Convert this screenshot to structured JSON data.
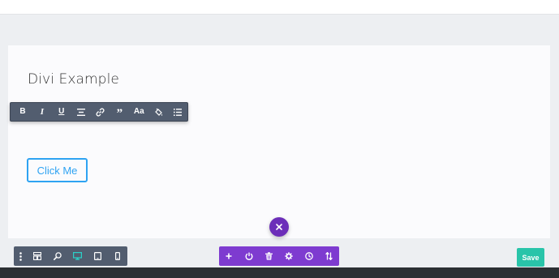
{
  "page": {
    "heading": "Divi Example",
    "cta_label": "Click Me"
  },
  "text_toolbar": {
    "items": [
      {
        "name": "bold",
        "glyph": "B"
      },
      {
        "name": "italic",
        "glyph": "I"
      },
      {
        "name": "underline",
        "glyph": "U"
      },
      {
        "name": "align",
        "glyph": "align-icon"
      },
      {
        "name": "link",
        "glyph": "link-icon"
      },
      {
        "name": "quote",
        "glyph": "”"
      },
      {
        "name": "font",
        "glyph": "Aa"
      },
      {
        "name": "text-color",
        "glyph": "paint-bucket-icon"
      },
      {
        "name": "list",
        "glyph": "list-icon"
      }
    ],
    "bold_label": "B",
    "italic_label": "I",
    "underline_label": "U",
    "quote_label": "”",
    "font_label": "Aa"
  },
  "view_toolbar": {
    "icons": [
      "menu-dots-icon",
      "wireframe-icon",
      "zoom-icon",
      "desktop-icon",
      "tablet-icon",
      "phone-icon"
    ],
    "active": "desktop-icon"
  },
  "action_toolbar": {
    "icons": [
      "plus-icon",
      "power-icon",
      "trash-icon",
      "settings-icon",
      "history-icon",
      "portability-icon"
    ]
  },
  "close_fab_icon": "close-icon",
  "save_label": "Save",
  "colors": {
    "builder_purple": "#7e3bd0",
    "fab_purple": "#6c2eb9",
    "toolbar_gray": "#525d6f",
    "cta_blue": "#2ea3f2",
    "save_green": "#29c4a9",
    "active_teal": "#2bd0c8"
  }
}
